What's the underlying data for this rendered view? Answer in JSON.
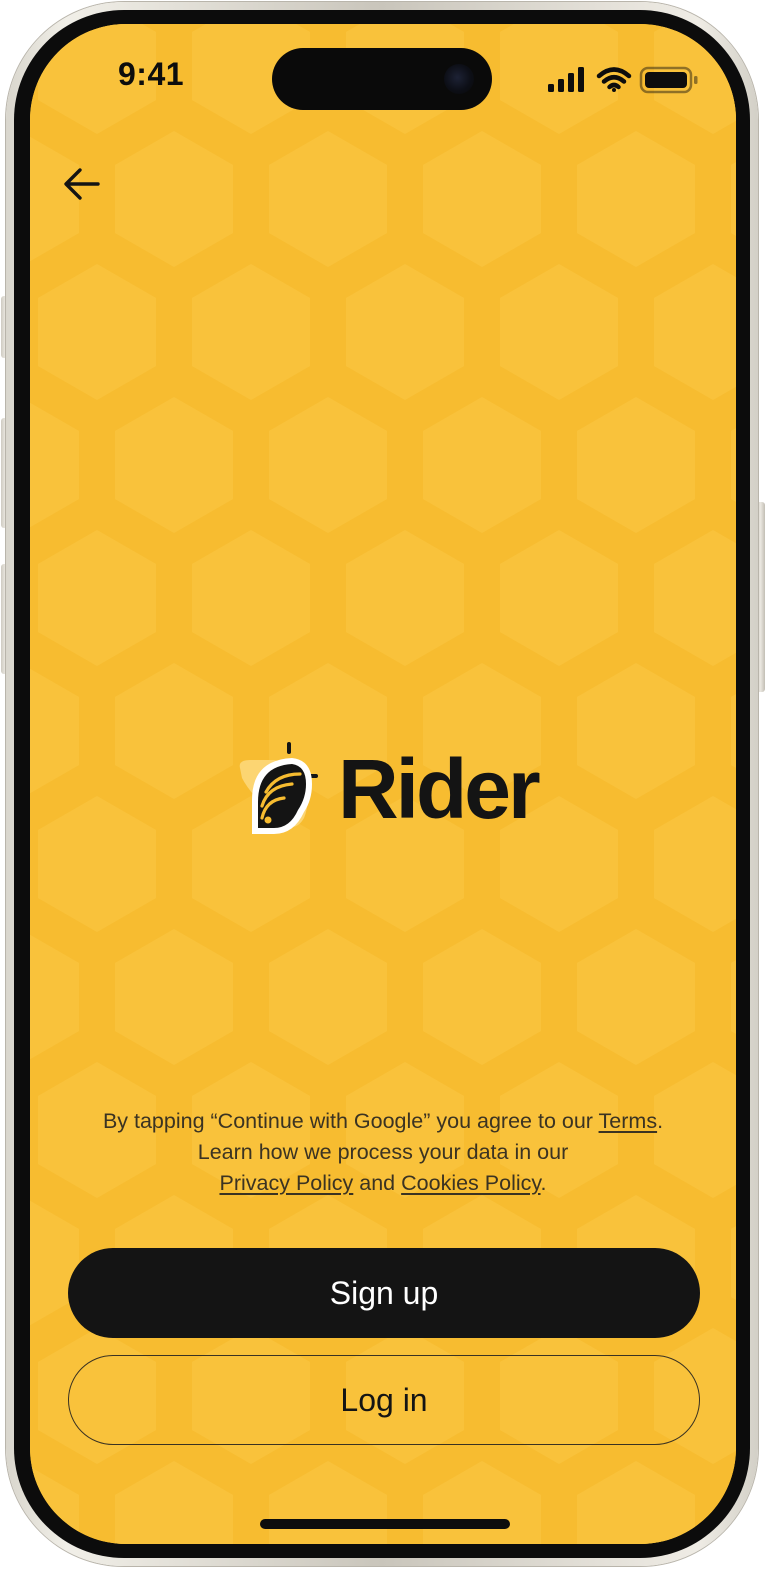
{
  "status_bar": {
    "time": "9:41",
    "icons": [
      "signal-icon",
      "wifi-icon",
      "battery-icon"
    ]
  },
  "nav": {
    "back_icon": "arrow-left-icon"
  },
  "brand": {
    "name": "Rider",
    "logo_icon": "rider-bee-logo-icon"
  },
  "legal": {
    "line1_prefix": "By tapping “Continue with Google” you agree to our ",
    "terms_link": "Terms",
    "line1_suffix": ".",
    "line2": "Learn how we process your data in our",
    "privacy_link": "Privacy Policy",
    "and_text": " and ",
    "cookies_link": "Cookies Policy",
    "line3_suffix": "."
  },
  "actions": {
    "signup_label": "Sign up",
    "login_label": "Log in"
  },
  "colors": {
    "background": "#f7bc30",
    "honeycomb_cell": "#f9c43f",
    "primary_button": "#141414",
    "text": "#141414"
  }
}
